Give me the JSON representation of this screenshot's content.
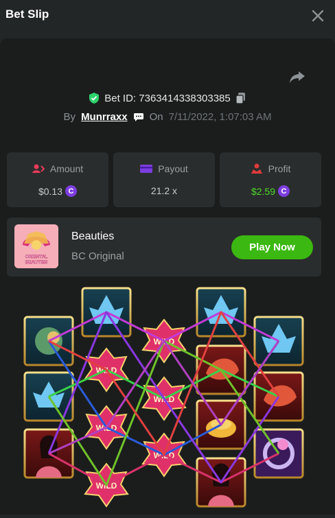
{
  "header": {
    "title": "Bet Slip"
  },
  "bet": {
    "id_label": "Bet ID: 7363414338303385",
    "by_label": "By",
    "username": "Munrraxx",
    "on_label": "On",
    "datetime": "7/11/2022, 1:07:03 AM"
  },
  "stats": {
    "amount_label": "Amount",
    "amount_value": "$0.13",
    "payout_label": "Payout",
    "payout_value": "21.2 x",
    "profit_label": "Profit",
    "profit_value": "$2.59"
  },
  "game": {
    "name": "Beauties",
    "subtitle": "BC Original",
    "play_label": "Play Now",
    "thumb_title": "ORIENTAL BEAUTIES"
  },
  "colors": {
    "accent_green": "#3bb811",
    "profit_green": "#4ddc29",
    "coin_purple": "#7c3ee0",
    "shield_green": "#2bd46b",
    "amount_icon": "#e93b5a",
    "payout_icon": "#7c3ee0",
    "profit_icon": "#e03b3b"
  },
  "icons": [
    "close-icon",
    "share-icon",
    "shield-check-icon",
    "copy-icon",
    "chat-icon",
    "amount-icon",
    "payout-icon",
    "profit-icon",
    "coin-icon"
  ]
}
